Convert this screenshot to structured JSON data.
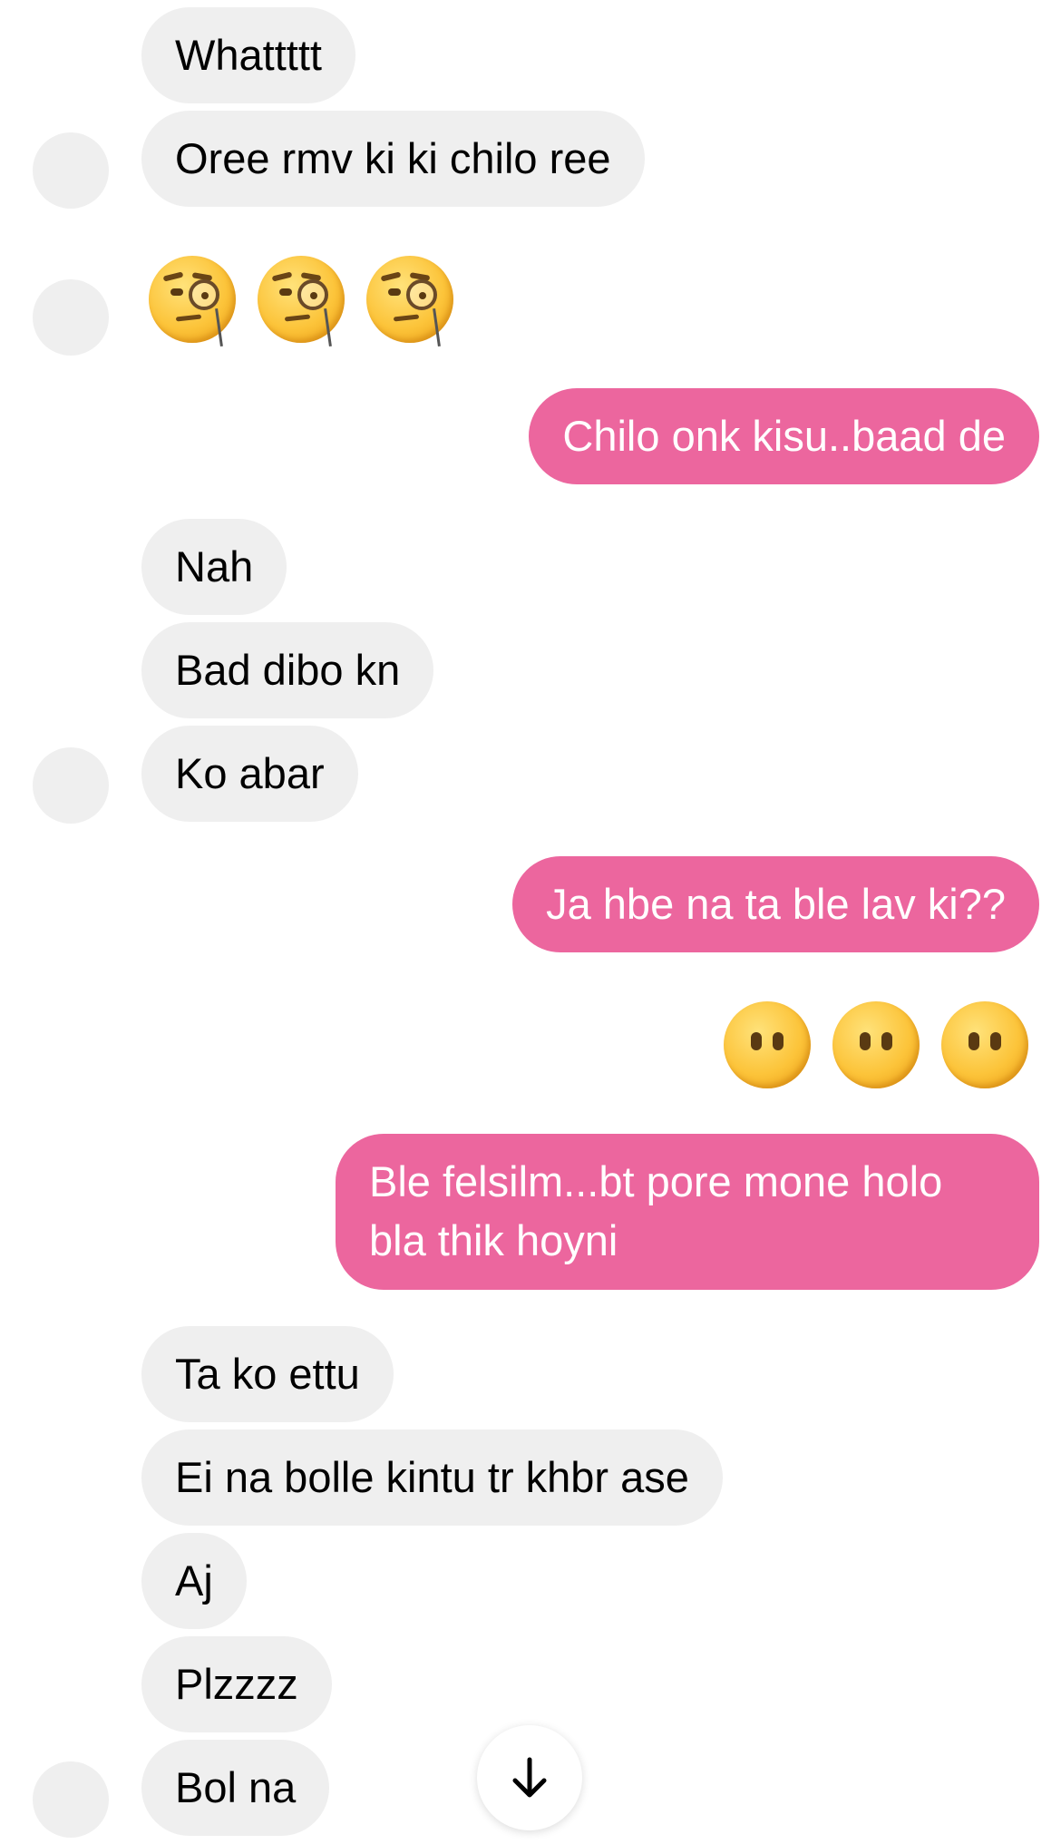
{
  "messages": [
    {
      "side": "in",
      "text": "Whattttt"
    },
    {
      "side": "in",
      "text": "Oree rmv ki ki chilo ree"
    },
    {
      "side": "in",
      "emoji": "face-with-monocle",
      "count": 3
    },
    {
      "side": "out",
      "text": "Chilo onk kisu..baad de"
    },
    {
      "side": "in",
      "text": "Nah"
    },
    {
      "side": "in",
      "text": "Bad dibo kn"
    },
    {
      "side": "in",
      "text": "Ko abar"
    },
    {
      "side": "out",
      "text": "Ja hbe na ta ble lav ki??"
    },
    {
      "side": "out",
      "emoji": "face-without-mouth",
      "count": 3
    },
    {
      "side": "out",
      "text": "Ble felsilm...bt pore mone holo bla thik hoyni"
    },
    {
      "side": "in",
      "text": "Ta ko ettu"
    },
    {
      "side": "in",
      "text": "Ei na bolle kintu tr khbr ase"
    },
    {
      "side": "in",
      "text": "Aj"
    },
    {
      "side": "in",
      "text": "Plzzzz"
    },
    {
      "side": "in",
      "text": "Bol na"
    }
  ],
  "colors": {
    "incoming_bubble": "#efefef",
    "outgoing_bubble": "#ec669e",
    "avatar_placeholder": "#efefef"
  },
  "scroll_button": {
    "icon": "arrow-down-icon"
  }
}
